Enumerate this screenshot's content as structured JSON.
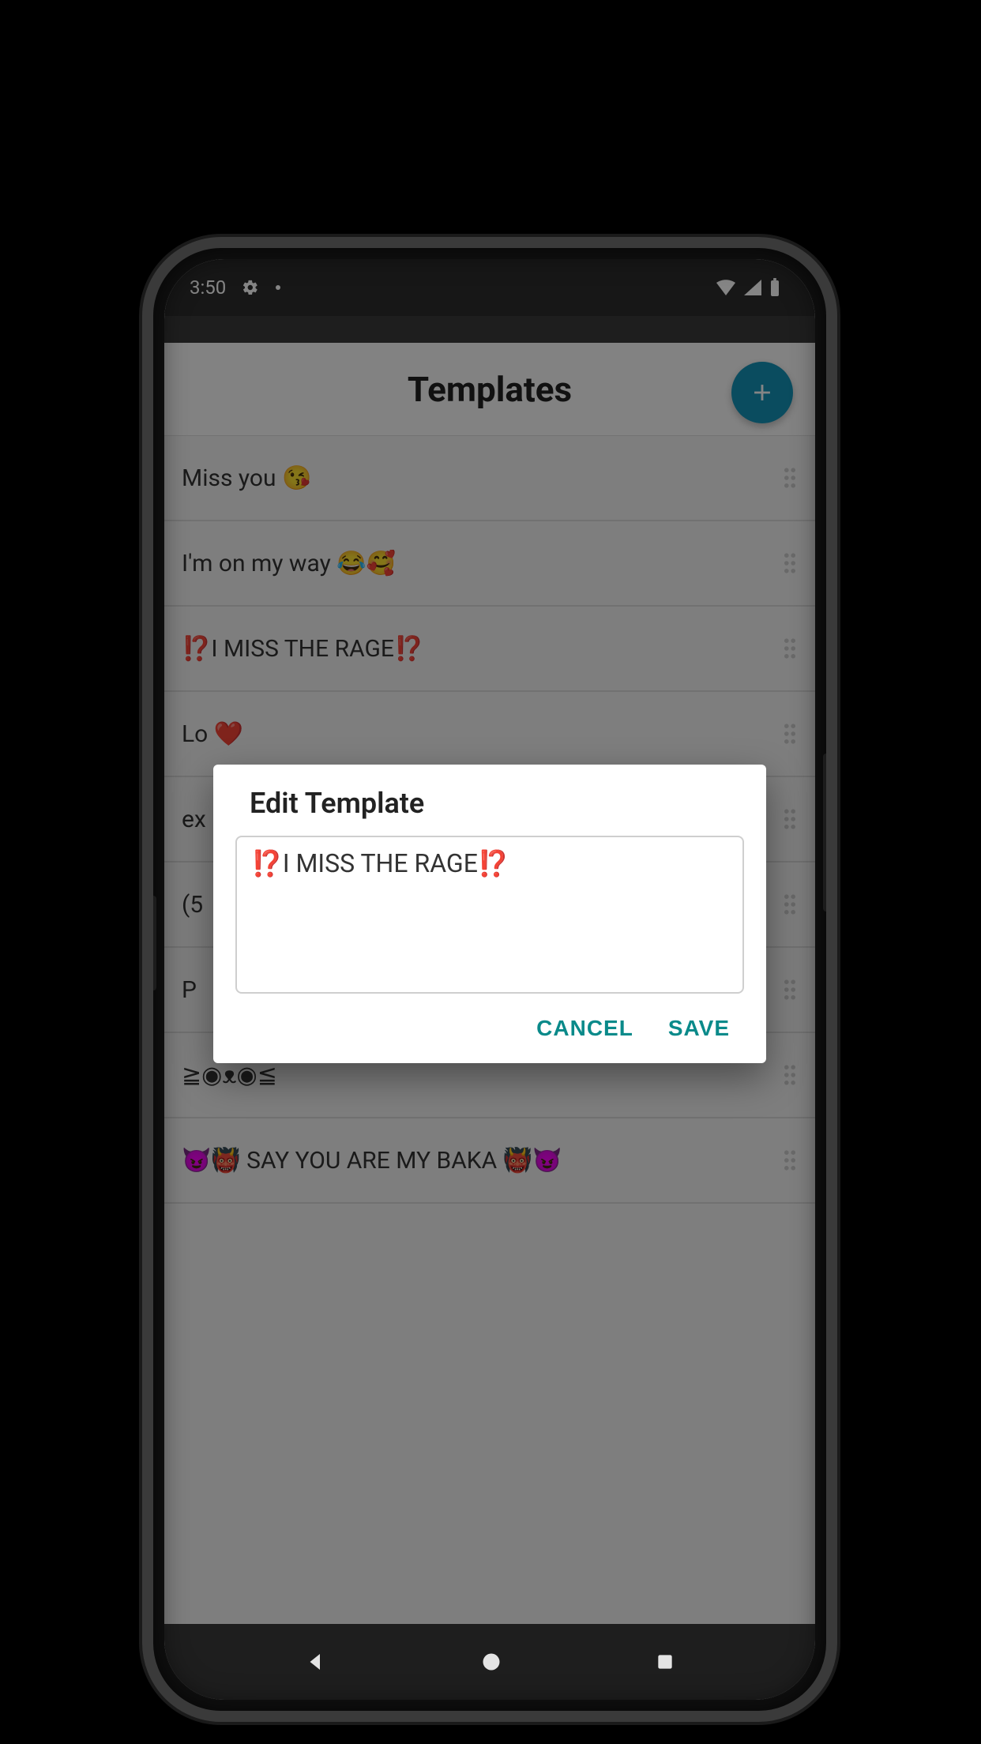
{
  "statusbar": {
    "time": "3:50"
  },
  "header": {
    "title": "Templates"
  },
  "list": {
    "items": [
      {
        "text": "Miss you 😘"
      },
      {
        "text": "I'm on my way 😂🥰"
      },
      {
        "text": "⁉️I MISS THE RAGE⁉️"
      },
      {
        "text": "Lo       ❤️"
      },
      {
        "text": "ex"
      },
      {
        "text": "(5"
      },
      {
        "text": "P"
      },
      {
        "text": "≧◉ᴥ◉≦"
      },
      {
        "text": "😈👹 SAY YOU ARE MY BAKA 👹😈"
      }
    ]
  },
  "dialog": {
    "title": "Edit Template",
    "value": "⁉️I MISS THE RAGE⁉️",
    "cancel": "CANCEL",
    "save": "SAVE"
  }
}
